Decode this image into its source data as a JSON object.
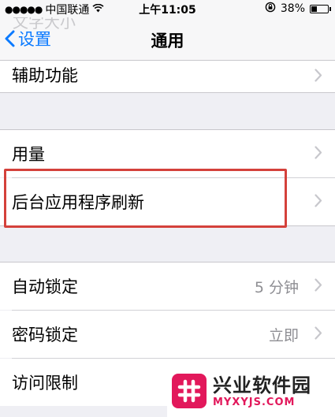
{
  "status_bar": {
    "signal_dots": "●●●●●",
    "carrier": "中国联通",
    "time": "上午11:05",
    "battery_percent": "38%",
    "battery_level": 0.38
  },
  "nav": {
    "ghost_title": "文字大小",
    "back_label": "设置",
    "title": "通用"
  },
  "rows": {
    "accessibility": {
      "label": "辅助功能"
    },
    "usage": {
      "label": "用量"
    },
    "background_refresh": {
      "label": "后台应用程序刷新"
    },
    "auto_lock": {
      "label": "自动锁定",
      "value": "5 分钟"
    },
    "passcode_lock": {
      "label": "密码锁定",
      "value": "立即"
    },
    "restrictions": {
      "label": "访问限制"
    }
  },
  "watermark": {
    "title": "兴业软件园",
    "url": "MYXYJS.COM"
  },
  "colors": {
    "accent": "#0a7aff",
    "highlight": "#d4413b",
    "watermark_brand": "#e2185b"
  }
}
